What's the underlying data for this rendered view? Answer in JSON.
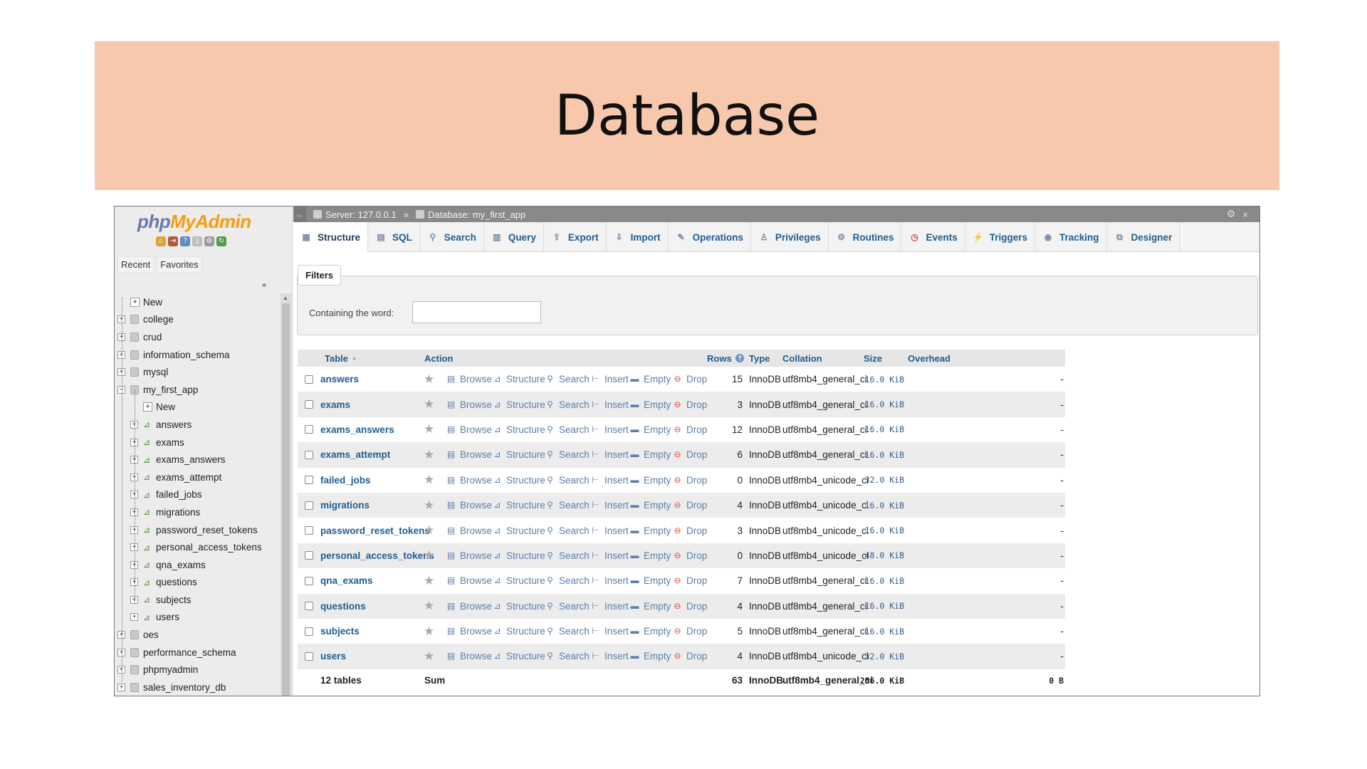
{
  "slide": {
    "title": "Database"
  },
  "sidebar": {
    "logo_part1": "php",
    "logo_part2": "MyAdmin",
    "tabs": [
      "Recent",
      "Favorites"
    ],
    "tree": [
      {
        "label": "New",
        "kind": "new",
        "level": 0
      },
      {
        "label": "college",
        "kind": "db",
        "level": 0
      },
      {
        "label": "crud",
        "kind": "db",
        "level": 0
      },
      {
        "label": "information_schema",
        "kind": "db",
        "level": 0
      },
      {
        "label": "mysql",
        "kind": "db",
        "level": 0
      },
      {
        "label": "my_first_app",
        "kind": "db-open",
        "level": 0
      },
      {
        "label": "New",
        "kind": "new",
        "level": 1
      },
      {
        "label": "answers",
        "kind": "table",
        "level": 1
      },
      {
        "label": "exams",
        "kind": "table",
        "level": 1
      },
      {
        "label": "exams_answers",
        "kind": "table",
        "level": 1
      },
      {
        "label": "exams_attempt",
        "kind": "table",
        "level": 1
      },
      {
        "label": "failed_jobs",
        "kind": "table",
        "level": 1
      },
      {
        "label": "migrations",
        "kind": "table",
        "level": 1
      },
      {
        "label": "password_reset_tokens",
        "kind": "table",
        "level": 1
      },
      {
        "label": "personal_access_tokens",
        "kind": "table",
        "level": 1
      },
      {
        "label": "qna_exams",
        "kind": "table",
        "level": 1
      },
      {
        "label": "questions",
        "kind": "table",
        "level": 1
      },
      {
        "label": "subjects",
        "kind": "table",
        "level": 1
      },
      {
        "label": "users",
        "kind": "table",
        "level": 1
      },
      {
        "label": "oes",
        "kind": "db",
        "level": 0
      },
      {
        "label": "performance_schema",
        "kind": "db",
        "level": 0
      },
      {
        "label": "phpmyadmin",
        "kind": "db",
        "level": 0
      },
      {
        "label": "sales_inventory_db",
        "kind": "db",
        "level": 0
      }
    ]
  },
  "breadcrumb": {
    "server": "Server: 127.0.0.1",
    "separator": "»",
    "database": "Database: my_first_app"
  },
  "tabs": [
    {
      "label": "Structure",
      "icon": "structure-icon",
      "active": true
    },
    {
      "label": "SQL",
      "icon": "sql-icon"
    },
    {
      "label": "Search",
      "icon": "search-icon"
    },
    {
      "label": "Query",
      "icon": "query-icon"
    },
    {
      "label": "Export",
      "icon": "export-icon"
    },
    {
      "label": "Import",
      "icon": "import-icon"
    },
    {
      "label": "Operations",
      "icon": "wrench-icon"
    },
    {
      "label": "Privileges",
      "icon": "privileges-icon"
    },
    {
      "label": "Routines",
      "icon": "routines-icon"
    },
    {
      "label": "Events",
      "icon": "clock-icon"
    },
    {
      "label": "Triggers",
      "icon": "triggers-icon"
    },
    {
      "label": "Tracking",
      "icon": "eye-icon"
    },
    {
      "label": "Designer",
      "icon": "designer-icon"
    }
  ],
  "filters": {
    "legend": "Filters",
    "label": "Containing the word:",
    "value": ""
  },
  "table": {
    "headers": {
      "table": "Table",
      "action": "Action",
      "rows": "Rows",
      "type": "Type",
      "collation": "Collation",
      "size": "Size",
      "overhead": "Overhead"
    },
    "actions": [
      "Browse",
      "Structure",
      "Search",
      "Insert",
      "Empty",
      "Drop"
    ],
    "rows": [
      {
        "name": "answers",
        "rows": "15",
        "type": "InnoDB",
        "collation": "utf8mb4_general_ci",
        "size": "16.0 KiB",
        "overhead": "-"
      },
      {
        "name": "exams",
        "rows": "3",
        "type": "InnoDB",
        "collation": "utf8mb4_general_ci",
        "size": "16.0 KiB",
        "overhead": "-"
      },
      {
        "name": "exams_answers",
        "rows": "12",
        "type": "InnoDB",
        "collation": "utf8mb4_general_ci",
        "size": "16.0 KiB",
        "overhead": "-"
      },
      {
        "name": "exams_attempt",
        "rows": "6",
        "type": "InnoDB",
        "collation": "utf8mb4_general_ci",
        "size": "16.0 KiB",
        "overhead": "-"
      },
      {
        "name": "failed_jobs",
        "rows": "0",
        "type": "InnoDB",
        "collation": "utf8mb4_unicode_ci",
        "size": "32.0 KiB",
        "overhead": "-"
      },
      {
        "name": "migrations",
        "rows": "4",
        "type": "InnoDB",
        "collation": "utf8mb4_unicode_ci",
        "size": "16.0 KiB",
        "overhead": "-"
      },
      {
        "name": "password_reset_tokens",
        "rows": "3",
        "type": "InnoDB",
        "collation": "utf8mb4_unicode_ci",
        "size": "16.0 KiB",
        "overhead": "-"
      },
      {
        "name": "personal_access_tokens",
        "rows": "0",
        "type": "InnoDB",
        "collation": "utf8mb4_unicode_ci",
        "size": "48.0 KiB",
        "overhead": "-"
      },
      {
        "name": "qna_exams",
        "rows": "7",
        "type": "InnoDB",
        "collation": "utf8mb4_general_ci",
        "size": "16.0 KiB",
        "overhead": "-"
      },
      {
        "name": "questions",
        "rows": "4",
        "type": "InnoDB",
        "collation": "utf8mb4_general_ci",
        "size": "16.0 KiB",
        "overhead": "-"
      },
      {
        "name": "subjects",
        "rows": "5",
        "type": "InnoDB",
        "collation": "utf8mb4_general_ci",
        "size": "16.0 KiB",
        "overhead": "-"
      },
      {
        "name": "users",
        "rows": "4",
        "type": "InnoDB",
        "collation": "utf8mb4_unicode_ci",
        "size": "32.0 KiB",
        "overhead": "-"
      }
    ],
    "footer": {
      "count": "12 tables",
      "sum": "Sum",
      "rows": "63",
      "type": "InnoDB",
      "collation": "utf8mb4_general_ci",
      "size": "256.0 KiB",
      "overhead": "0 B"
    }
  }
}
